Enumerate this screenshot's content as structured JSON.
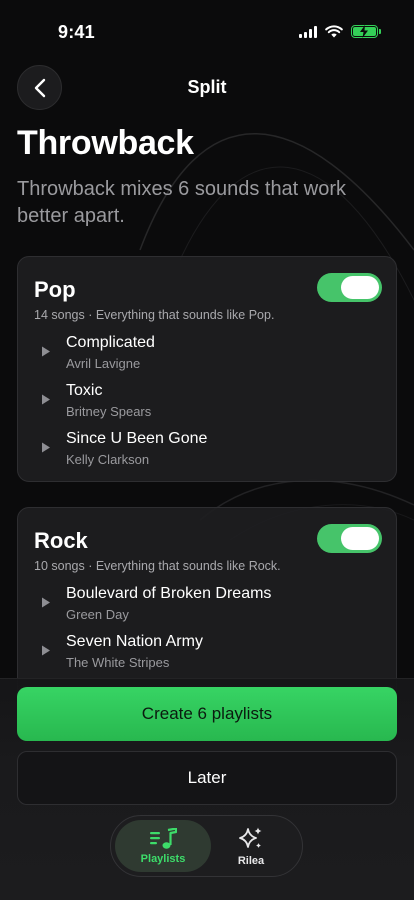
{
  "status_bar": {
    "time": "9:41"
  },
  "header": {
    "title": "Split"
  },
  "page": {
    "title": "Throwback",
    "subtitle": "Throwback mixes 6 sounds that work better apart."
  },
  "groups": [
    {
      "name": "Pop",
      "enabled": true,
      "description": "14 songs · Everything that sounds like Pop.",
      "songs": [
        {
          "title": "Complicated",
          "artist": "Avril Lavigne"
        },
        {
          "title": "Toxic",
          "artist": "Britney Spears"
        },
        {
          "title": "Since U Been Gone",
          "artist": "Kelly Clarkson"
        }
      ]
    },
    {
      "name": "Rock",
      "enabled": true,
      "description": "10 songs · Everything that sounds like Rock.",
      "songs": [
        {
          "title": "Boulevard of Broken Dreams",
          "artist": "Green Day"
        },
        {
          "title": "Seven Nation Army",
          "artist": "The White Stripes"
        }
      ]
    }
  ],
  "actions": {
    "primary_label": "Create 6 playlists",
    "secondary_label": "Later"
  },
  "tabbar": {
    "tabs": [
      {
        "label": "Playlists",
        "icon": "music-note-list-icon",
        "active": true
      },
      {
        "label": "Rilea",
        "icon": "sparkles-icon",
        "active": false
      }
    ]
  },
  "colors": {
    "accent": "#37d464",
    "background": "#0b0b0c",
    "card": "#1e1e21"
  }
}
